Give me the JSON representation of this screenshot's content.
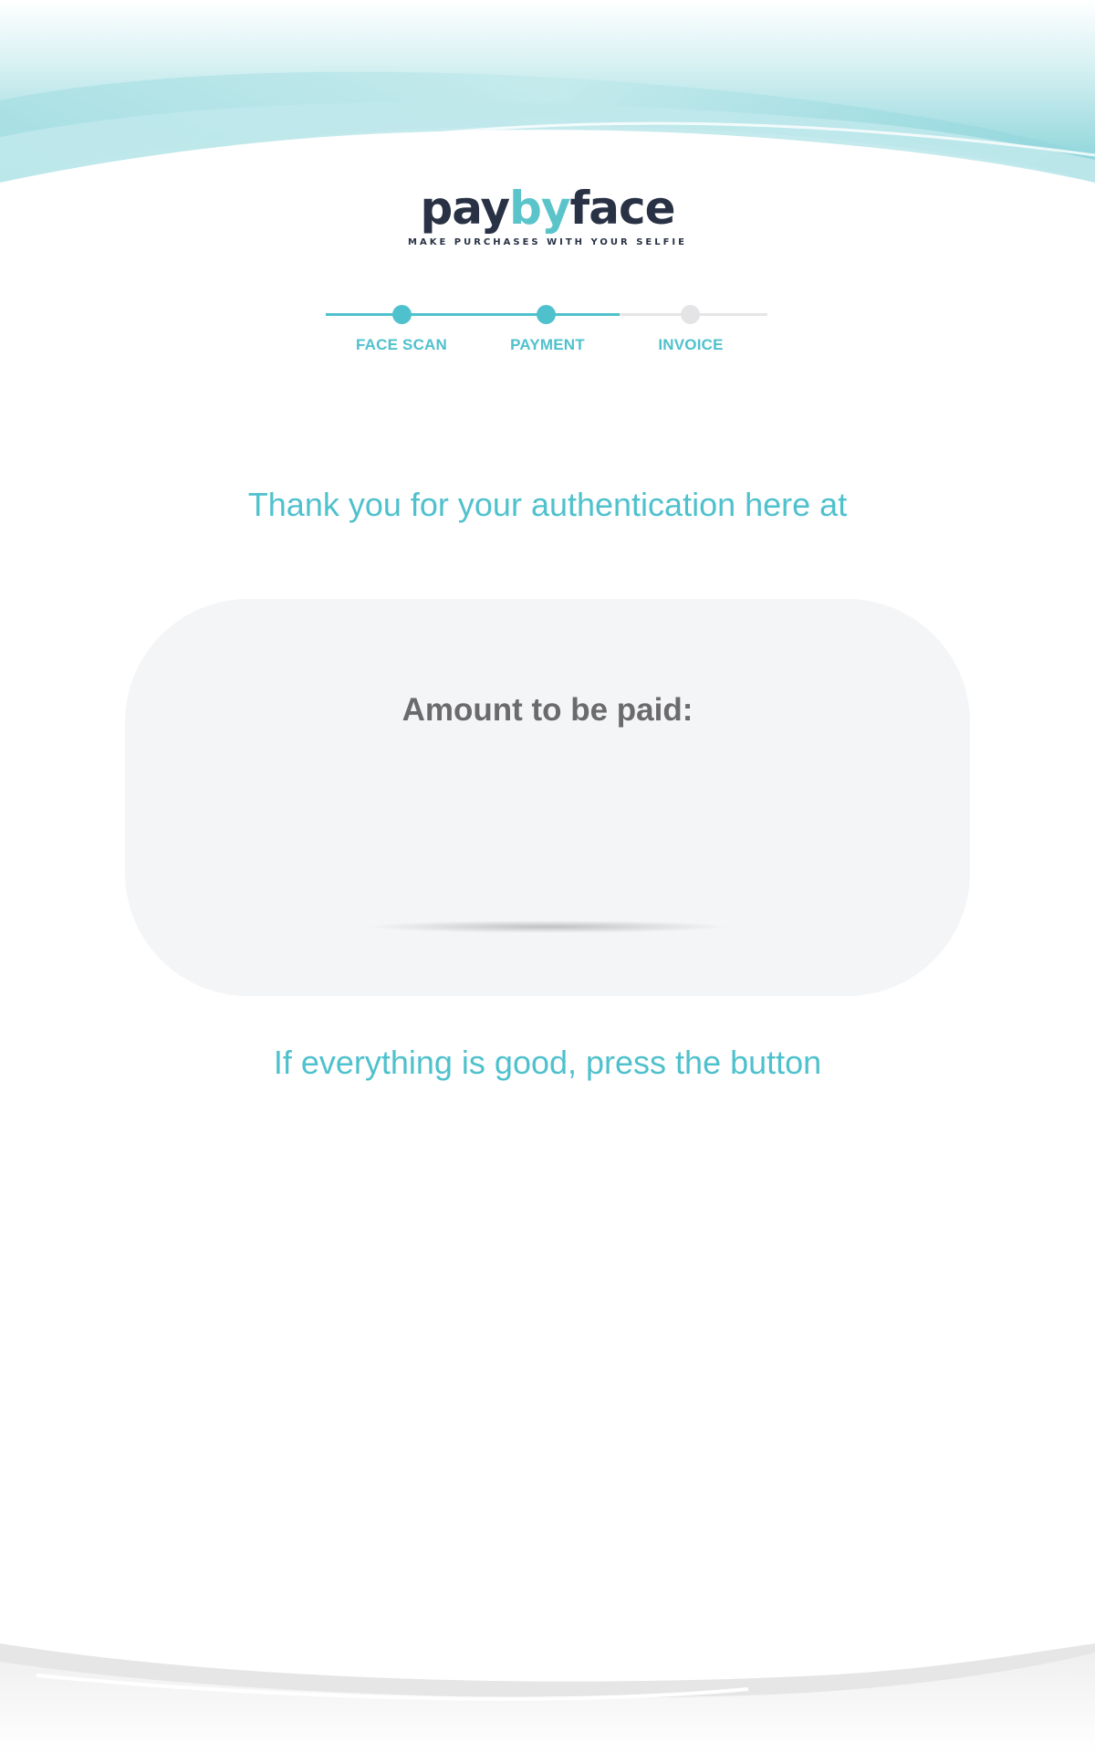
{
  "brand": {
    "name_part1": "pay",
    "name_part2": "by",
    "name_part3": "face",
    "tagline": "MAKE PURCHASES WITH YOUR SELFIE",
    "accent_color": "#5bc4cb",
    "dark_color": "#283244"
  },
  "stepper": {
    "steps": [
      {
        "label": "FACE SCAN",
        "state": "complete"
      },
      {
        "label": "PAYMENT",
        "state": "current"
      },
      {
        "label": "INVOICE",
        "state": "pending"
      }
    ],
    "active_color": "#4fc1cd",
    "inactive_color": "#e4e4e6"
  },
  "main": {
    "thanks_text": "Thank you for your authentication here at",
    "amount_label": "Amount to be paid:",
    "prompt_text": "If everything is good, press the button"
  }
}
